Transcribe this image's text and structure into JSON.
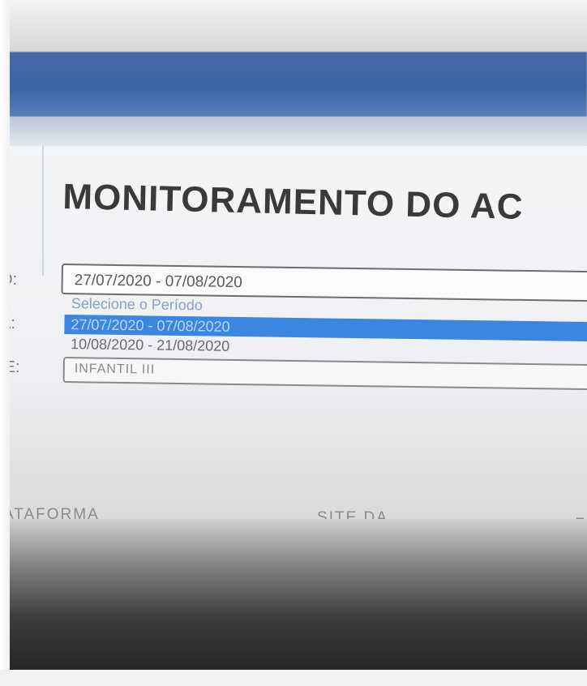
{
  "header": {
    "title": "MONITORAMENTO DO AC"
  },
  "form": {
    "labels": [
      "O:",
      "A:",
      "IE:"
    ],
    "period_select": {
      "value": "27/07/2020 - 07/08/2020",
      "options": [
        {
          "label": "Selecione o Período",
          "state": "placeholder"
        },
        {
          "label": "27/07/2020 - 07/08/2020",
          "state": "selected"
        },
        {
          "label": "10/08/2020 - 21/08/2020",
          "state": "normal"
        }
      ]
    },
    "series_select": {
      "value": "INFANTIL III"
    }
  },
  "links": {
    "plataforma": "ATAFORMA\nEAD",
    "site": "SITE DA\nPREFEITURA",
    "right_cut": "F"
  },
  "colors": {
    "header_blue": "#3c64a6",
    "selected_option": "#3a86e0",
    "title_text": "#3a3a3a"
  }
}
